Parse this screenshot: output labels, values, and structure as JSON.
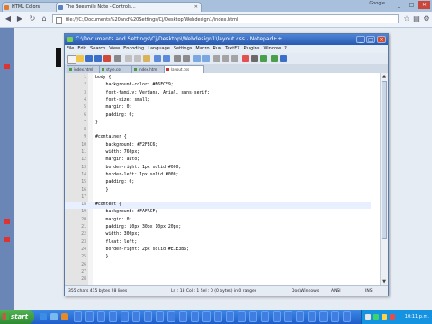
{
  "browser": {
    "tabs": [
      {
        "title": "HTML Colors",
        "active": false
      },
      {
        "title": "The Beesmile Note - Controls...",
        "active": true
      }
    ],
    "top_right_label": "Google",
    "window_controls": [
      "_",
      "□",
      "✕"
    ],
    "address": "file:///C:/Documents%20and%20Settings/Cj/Desktop/Webdesign1/index.html"
  },
  "notepad": {
    "title": "C:\\Documents and Settings\\Cj\\Desktop\\Webdesign1\\layout.css - Notepad++",
    "window_controls": [
      "_",
      "□",
      "✕"
    ],
    "menu": [
      "File",
      "Edit",
      "Search",
      "View",
      "Encoding",
      "Language",
      "Settings",
      "Macro",
      "Run",
      "TextFX",
      "Plugins",
      "Window",
      "?"
    ],
    "file_tabs": [
      {
        "name": "index.html",
        "active": false
      },
      {
        "name": "style.css",
        "active": false
      },
      {
        "name": "index.html",
        "active": false
      },
      {
        "name": "layout.css",
        "active": true
      }
    ],
    "code_lines": [
      {
        "n": "1",
        "text": "body {"
      },
      {
        "n": "2",
        "text": "    background-color: #E6FCF9;"
      },
      {
        "n": "3",
        "text": "    font-family: Verdana, Arial, sans-serif;"
      },
      {
        "n": "4",
        "text": "    font-size: small;"
      },
      {
        "n": "5",
        "text": "    margin: 0;"
      },
      {
        "n": "6",
        "text": "    padding: 0;"
      },
      {
        "n": "7",
        "text": "}"
      },
      {
        "n": "8",
        "text": ""
      },
      {
        "n": "9",
        "text": "#container {"
      },
      {
        "n": "10",
        "text": "    background: #F2F3C6;"
      },
      {
        "n": "11",
        "text": "    width: 760px;"
      },
      {
        "n": "12",
        "text": "    margin: auto;"
      },
      {
        "n": "13",
        "text": "    border-right: 1px solid #000;"
      },
      {
        "n": "14",
        "text": "    border-left: 1px solid #000;"
      },
      {
        "n": "15",
        "text": "    padding: 0;"
      },
      {
        "n": "16",
        "text": "    }"
      },
      {
        "n": "17",
        "text": ""
      },
      {
        "n": "18",
        "text": "#content {"
      },
      {
        "n": "19",
        "text": "    background: #FAFACF;"
      },
      {
        "n": "20",
        "text": "    margin: 0;"
      },
      {
        "n": "21",
        "text": "    padding: 10px 30px 10px 20px;"
      },
      {
        "n": "22",
        "text": "    width: 300px;"
      },
      {
        "n": "23",
        "text": "    float: left;"
      },
      {
        "n": "24",
        "text": "    border-right: 2px solid #E1E3B6;"
      },
      {
        "n": "25",
        "text": "    }"
      },
      {
        "n": "26",
        "text": ""
      },
      {
        "n": "27",
        "text": ""
      },
      {
        "n": "28",
        "text": ""
      }
    ],
    "status": {
      "length": "355 chars   415 bytes   28 lines",
      "position": "Ln : 18   Col : 1   Sel : 0 (0 bytes) in 0 ranges",
      "eol": "Dos\\Windows",
      "encoding": "ANSI",
      "mode": "INS"
    }
  },
  "taskbar": {
    "start_label": "start",
    "clock": "10:11 p.m."
  },
  "colors": {
    "desktop": "#3a6ea5",
    "notepad_title": "#2858b0",
    "start_green": "#3b9b3d",
    "taskbar_blue": "#1f5cc9",
    "css_hex_accent": "#000000"
  }
}
